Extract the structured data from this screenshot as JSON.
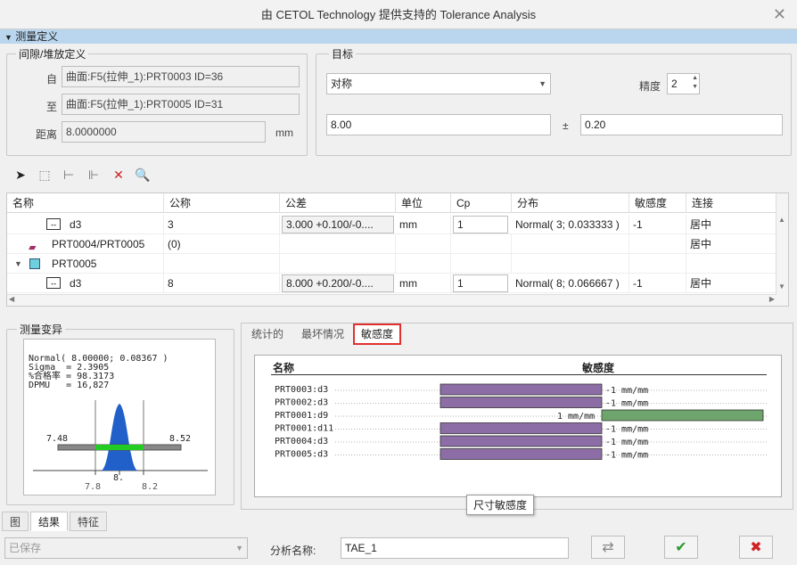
{
  "window": {
    "title": "由 CETOL Technology 提供支持的 Tolerance Analysis",
    "close_glyph": "✕"
  },
  "section": {
    "label": "测量定义"
  },
  "gap_group": {
    "title": "间隙/堆放定义",
    "from_label": "自",
    "from_value": "曲面:F5(拉伸_1):PRT0003 ID=36",
    "to_label": "至",
    "to_value": "曲面:F5(拉伸_1):PRT0005 ID=31",
    "distance_label": "距离",
    "distance_value": "8.0000000",
    "unit": "mm"
  },
  "target_group": {
    "title": "目标",
    "type_value": "对称",
    "precision_label": "精度",
    "precision_value": "2",
    "nominal_value": "8.00",
    "pm": "±",
    "tolerance_value": "0.20"
  },
  "table": {
    "headers": [
      "名称",
      "公称",
      "公差",
      "单位",
      "Cp",
      "分布",
      "敏感度",
      "连接"
    ],
    "rows": [
      {
        "name": "d3",
        "nominal": "3",
        "tolerance": "3.000 +0.100/-0....",
        "unit": "mm",
        "cp": "1",
        "dist": "Normal( 3; 0.033333 )",
        "sens": "-1",
        "conn": "居中"
      },
      {
        "name": "PRT0004/PRT0005",
        "nominal": "(0)",
        "tolerance": "",
        "unit": "",
        "cp": "",
        "dist": "",
        "sens": "",
        "conn": "居中"
      },
      {
        "name": "PRT0005",
        "nominal": "",
        "tolerance": "",
        "unit": "",
        "cp": "",
        "dist": "",
        "sens": "",
        "conn": ""
      },
      {
        "name": "d3",
        "nominal": "8",
        "tolerance": "8.000 +0.200/-0....",
        "unit": "mm",
        "cp": "1",
        "dist": "Normal( 8; 0.066667 )",
        "sens": "-1",
        "conn": "居中"
      }
    ]
  },
  "variation": {
    "title": "测量变异",
    "stats": [
      "Normal( 8.00000; 0.08367 )",
      "Sigma  = 2.3905",
      "%合格率 = 98.3173",
      "DPMU   = 16,827"
    ],
    "lower": "7.48",
    "upper": "8.52",
    "axis_left": "7.8",
    "axis_center": "8.",
    "axis_right": "8.2"
  },
  "result_tabs": [
    "统计的",
    "最坏情况",
    "敏感度"
  ],
  "sensitivity": {
    "header_name": "名称",
    "header_sens": "敏感度",
    "rows": [
      {
        "name": "PRT0003:d3",
        "value": -1,
        "label": "-1  mm/mm"
      },
      {
        "name": "PRT0002:d3",
        "value": -1,
        "label": "-1  mm/mm"
      },
      {
        "name": "PRT0001:d9",
        "value": 1,
        "label": "1  mm/mm"
      },
      {
        "name": "PRT0001:d11",
        "value": -1,
        "label": "-1  mm/mm"
      },
      {
        "name": "PRT0004:d3",
        "value": -1,
        "label": "-1  mm/mm"
      },
      {
        "name": "PRT0005:d3",
        "value": -1,
        "label": "-1  mm/mm"
      }
    ],
    "tooltip": "尺寸敏感度"
  },
  "bottom_tabs": [
    "图",
    "结果",
    "特征"
  ],
  "footer": {
    "saved_value": "已保存",
    "analysis_name_label": "分析名称:",
    "analysis_name_value": "TAE_1"
  },
  "colors": {
    "neg_bar": "#8d6da6",
    "pos_bar": "#6ea56c",
    "tab_highlight": "#e03030",
    "header_blue": "#b9d6ee"
  }
}
